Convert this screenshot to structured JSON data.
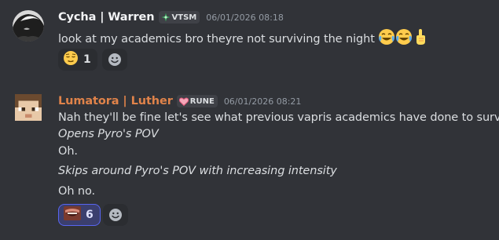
{
  "colors": {
    "background": "#313338",
    "cycha_name": "#f2f3f5",
    "luther_name": "#e0834a",
    "timestamp": "#949ba4",
    "reaction_selected_border": "#5865f2"
  },
  "messages": [
    {
      "author": "Cycha | Warren",
      "tag": {
        "icon": "sparkle-diamond-icon",
        "label": "VTSM"
      },
      "timestamp": "06/01/2026 08:18",
      "lines": [
        {
          "text": "look at my academics bro theyre not surviving the night",
          "trailing_emoji": [
            "joy-emoji",
            "joy-emoji",
            "point-up-emoji"
          ]
        }
      ],
      "reactions": [
        {
          "emoji": "relieved-face-emoji",
          "count": "1",
          "selected": false
        }
      ]
    },
    {
      "author": "Lumatora | Luther",
      "tag": {
        "icon": "heart-icon",
        "label": "RUNE"
      },
      "timestamp": "06/01/2026 08:21",
      "lines": [
        {
          "text": "Nah they'll be fine let's see what previous vapris academics have done to survi-",
          "italic": false
        },
        {
          "text": "Opens Pyro's POV",
          "italic": true
        },
        {
          "text": "Oh.",
          "italic": false
        },
        {
          "text": "Skips around Pyro's POV with increasing intensity",
          "italic": true
        },
        {
          "text": "Oh no.",
          "italic": false
        }
      ],
      "reactions": [
        {
          "emoji": "custom-mouth-emoji",
          "count": "6",
          "selected": true
        }
      ]
    }
  ]
}
